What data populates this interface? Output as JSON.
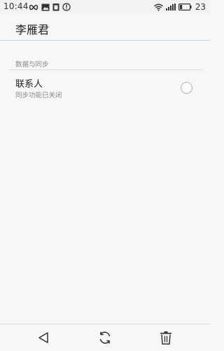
{
  "status_bar": {
    "time": "10:44",
    "left_icons": [
      "infinity-icon",
      "image-icon",
      "clipboard-icon",
      "info-icon"
    ],
    "right_icons": [
      "wifi-icon",
      "signal-icon",
      "battery-icon"
    ],
    "battery_level": "23"
  },
  "app_bar": {
    "title": "李雁君"
  },
  "section": {
    "header": "数据与同步"
  },
  "contacts_item": {
    "title": "联系人",
    "subtitle": "同步功能已关闭",
    "checked": false
  },
  "bottom_bar": {
    "buttons": [
      "back-icon",
      "sync-icon",
      "delete-icon"
    ]
  },
  "colors": {
    "accent_line": "#bdd3e2",
    "background": "#f7f7f7"
  }
}
